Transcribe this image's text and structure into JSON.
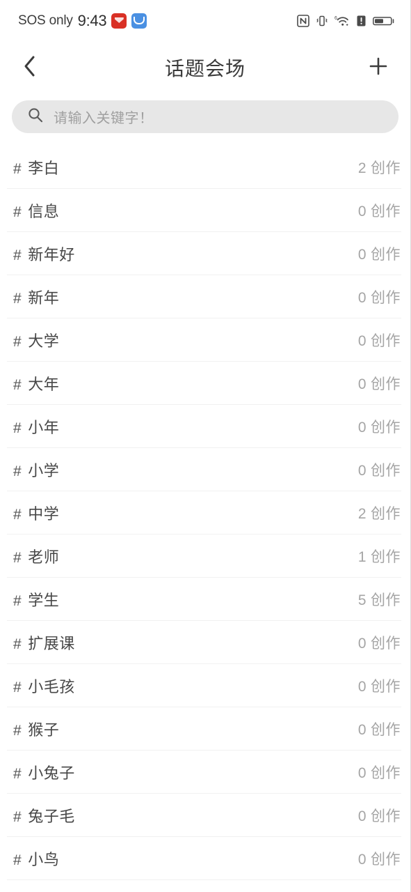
{
  "status_bar": {
    "carrier": "SOS only",
    "time": "9:43",
    "notification_icons": [
      "app-badge-red",
      "app-badge-blue"
    ],
    "right_icons": [
      "nfc-icon",
      "vibrate-icon",
      "wifi-6-icon",
      "alert-icon",
      "battery-icon"
    ]
  },
  "header": {
    "back_label": "‹",
    "title": "话题会场",
    "add_label": "+"
  },
  "search": {
    "placeholder": "请输入关键字！",
    "value": ""
  },
  "list": {
    "count_suffix": "创作",
    "hash_symbol": "#",
    "items": [
      {
        "name": "李白",
        "count": "2",
        "suffix": "创作",
        "hash": "#"
      },
      {
        "name": "信息",
        "count": "0",
        "suffix": "创作",
        "hash": "#"
      },
      {
        "name": "新年好",
        "count": "0",
        "suffix": "创作",
        "hash": "#"
      },
      {
        "name": "新年",
        "count": "0",
        "suffix": "创作",
        "hash": "#"
      },
      {
        "name": "大学",
        "count": "0",
        "suffix": "创作",
        "hash": "#"
      },
      {
        "name": "大年",
        "count": "0",
        "suffix": "创作",
        "hash": "#"
      },
      {
        "name": "小年",
        "count": "0",
        "suffix": "创作",
        "hash": "#"
      },
      {
        "name": "小学",
        "count": "0",
        "suffix": "创作",
        "hash": "#"
      },
      {
        "name": "中学",
        "count": "2",
        "suffix": "创作",
        "hash": "#"
      },
      {
        "name": "老师",
        "count": "1",
        "suffix": "创作",
        "hash": "#"
      },
      {
        "name": "学生",
        "count": "5",
        "suffix": "创作",
        "hash": "#"
      },
      {
        "name": "扩展课",
        "count": "0",
        "suffix": "创作",
        "hash": "#"
      },
      {
        "name": "小毛孩",
        "count": "0",
        "suffix": "创作",
        "hash": "#"
      },
      {
        "name": "猴子",
        "count": "0",
        "suffix": "创作",
        "hash": "#"
      },
      {
        "name": "小兔子",
        "count": "0",
        "suffix": "创作",
        "hash": "#"
      },
      {
        "name": "兔子毛",
        "count": "0",
        "suffix": "创作",
        "hash": "#"
      },
      {
        "name": "小鸟",
        "count": "0",
        "suffix": "创作",
        "hash": "#"
      }
    ]
  },
  "colors": {
    "background": "#ffffff",
    "search_bg": "#e7e7e7",
    "divider": "#f1f1f1",
    "text_primary": "#474747",
    "text_secondary": "#a5a5a5",
    "badge_red": "#d93025",
    "badge_blue": "#4a90e2"
  }
}
